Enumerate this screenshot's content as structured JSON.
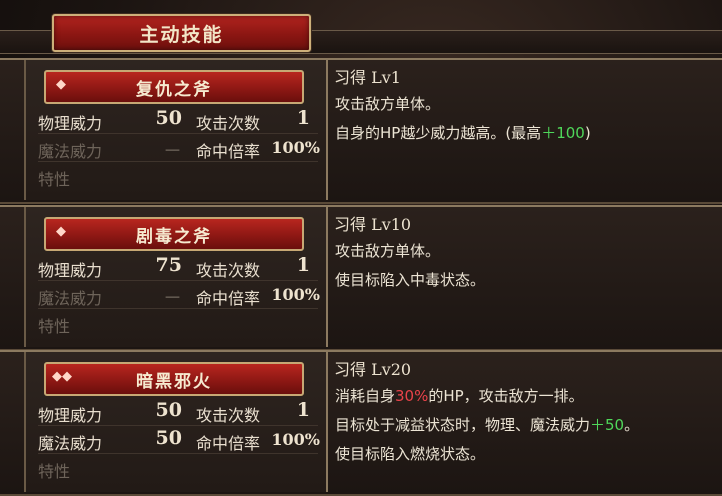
{
  "header": {
    "tab_label": "主动技能"
  },
  "skills": [
    {
      "name": "复仇之斧",
      "icon": "gem-icon",
      "labels": {
        "phys": "物理威力",
        "magic": "魔法威力",
        "trait": "特性",
        "hits": "攻击次数",
        "accuracy": "命中倍率"
      },
      "phys_power": "50",
      "magic_power": "－",
      "hits": "1",
      "accuracy": "100%",
      "level": "习得 Lv1",
      "desc_1": "攻击敌方单体。",
      "desc_2a": "自身的HP越少威力越高。(最高",
      "desc_2b": "＋100",
      "desc_2c": ")"
    },
    {
      "name": "剧毒之斧",
      "icon": "gem-icon",
      "labels": {
        "phys": "物理威力",
        "magic": "魔法威力",
        "trait": "特性",
        "hits": "攻击次数",
        "accuracy": "命中倍率"
      },
      "phys_power": "75",
      "magic_power": "－",
      "hits": "1",
      "accuracy": "100%",
      "level": "习得 Lv10",
      "desc_1": "攻击敌方单体。",
      "desc_2": "使目标陷入中毒状态。"
    },
    {
      "name": "暗黑邪火",
      "icon": "gem-double-icon",
      "labels": {
        "phys": "物理威力",
        "magic": "魔法威力",
        "trait": "特性",
        "hits": "攻击次数",
        "accuracy": "命中倍率"
      },
      "phys_power": "50",
      "magic_power": "50",
      "hits": "1",
      "accuracy": "100%",
      "level": "习得 Lv20",
      "desc_1a": "消耗自身",
      "desc_1b": "30%",
      "desc_1c": "的HP，攻击敌方一排。",
      "desc_2a": "目标处于减益状态时，物理、魔法威力",
      "desc_2b": "＋50",
      "desc_2c": "。",
      "desc_3": "使目标陷入燃烧状态。"
    }
  ],
  "colors": {
    "accent_red": "#a81d18",
    "highlight_red": "#e8434a",
    "highlight_green": "#4fd75a",
    "gold": "#c7a874"
  }
}
